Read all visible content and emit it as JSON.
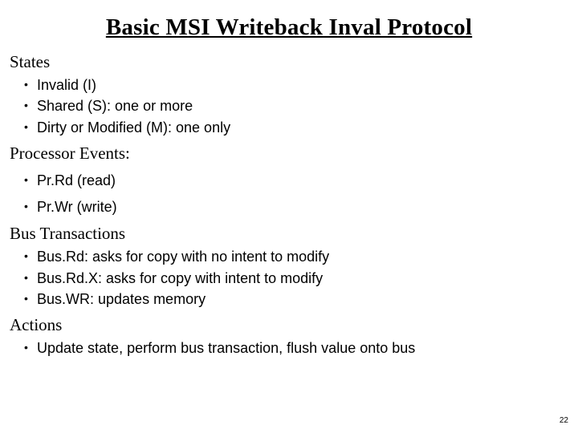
{
  "title": "Basic MSI Writeback Inval Protocol",
  "sections": {
    "states": {
      "heading": "States",
      "items": [
        "Invalid (I)",
        "Shared (S): one or more",
        "Dirty or Modified (M): one only"
      ]
    },
    "processor_events": {
      "heading": "Processor Events:",
      "items": [
        "Pr.Rd (read)",
        "Pr.Wr (write)"
      ]
    },
    "bus_transactions": {
      "heading": "Bus Transactions",
      "items": [
        "Bus.Rd: asks for copy with no intent to modify",
        "Bus.Rd.X: asks for copy with intent to modify",
        "Bus.WR: updates memory"
      ]
    },
    "actions": {
      "heading": "Actions",
      "items": [
        "Update state, perform bus transaction, flush value onto bus"
      ]
    }
  },
  "page_number": "22"
}
